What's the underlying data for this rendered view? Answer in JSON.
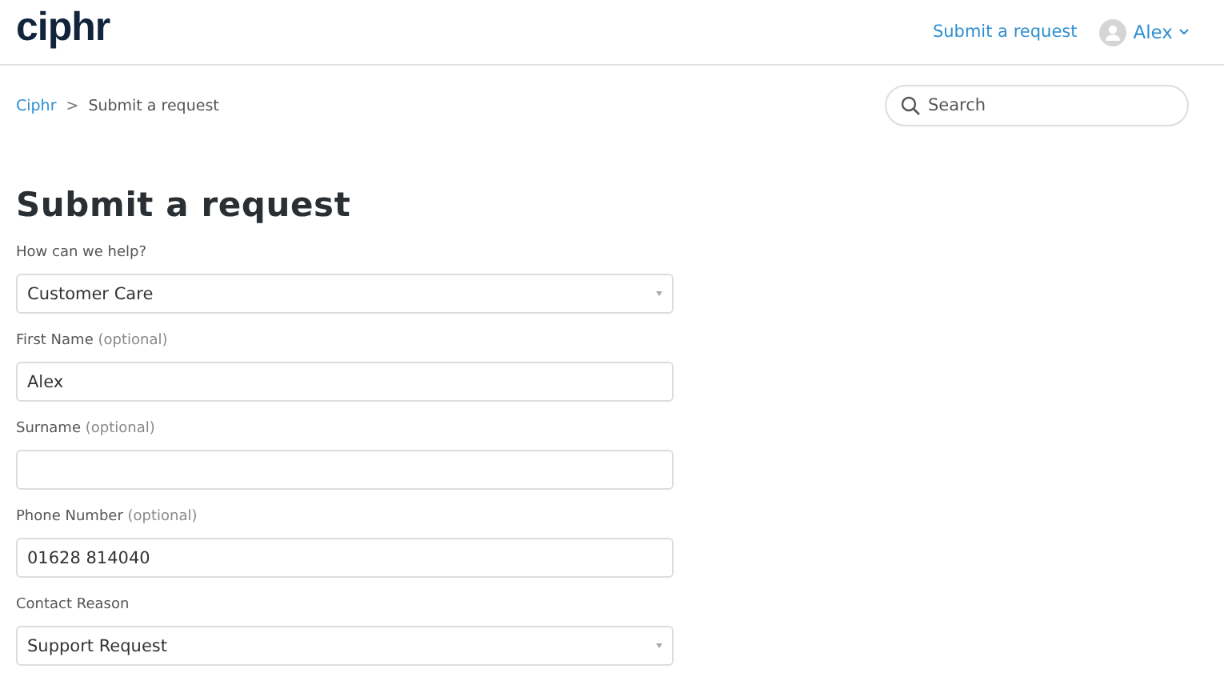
{
  "header": {
    "logo": "ciphr",
    "nav_link": "Submit a request",
    "user": "Alex"
  },
  "breadcrumb": [
    {
      "label": "Ciphr",
      "kind": "link"
    },
    {
      "label": "Submit a request",
      "kind": "current"
    }
  ],
  "breadcrumb_separator": ">",
  "search": {
    "placeholder": "Search"
  },
  "title": "Submit a request",
  "fields": [
    {
      "label": "How can we help?",
      "kind": "select",
      "value": "Customer Care"
    },
    {
      "label": "First Name",
      "note": "(optional)",
      "kind": "text",
      "value": "Alex"
    },
    {
      "label": "Surname",
      "note": "(optional)",
      "kind": "text"
    },
    {
      "label": "Phone Number",
      "note": "(optional)",
      "kind": "text",
      "value": "01628 814040"
    },
    {
      "label": "Contact Reason",
      "kind": "select",
      "value": "Support Request"
    }
  ]
}
